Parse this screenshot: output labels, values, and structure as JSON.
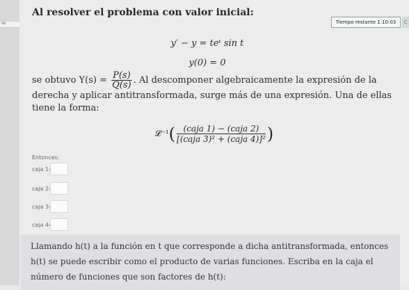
{
  "sidebar": {
    "tab_text": "no"
  },
  "timer": {
    "label": "Tiempo restante 1:10:03",
    "edge_icon": "C"
  },
  "problem": {
    "intro": "Al resolver el problema con valor inicial:",
    "equation_1": "y′ − y = teᵗ sin t",
    "equation_2": "y(0) = 0",
    "description_prefix": "se obtuvo Y(s) =",
    "fraction_numerator": "P(s)",
    "fraction_denominator": "Q(s)",
    "description_suffix": ". Al descomponer algebraicamente la expresión de la derecha y aplicar antitransformada, surge más de una expresión. Una de ellas tiene la forma:",
    "inverse_prefix": "𝓛⁻¹",
    "big_numerator": "(caja 1) − (caja 2)",
    "big_denominator": "[(caja 3)² + (caja 4)]²"
  },
  "answers": {
    "label": "Entonces:",
    "boxes": [
      {
        "label": "caja 1=",
        "value": ""
      },
      {
        "label": "caja 2=",
        "value": ""
      },
      {
        "label": "caja 3=",
        "value": ""
      },
      {
        "label": "caja 4=",
        "value": ""
      }
    ]
  },
  "next": {
    "text": "Llamando h(t) a la función en t que corresponde a dicha antitransformada, entonces h(t) se puede escribir como el producto de varias funciones. Escriba en la caja el número de funciones que son factores de h(t):"
  }
}
